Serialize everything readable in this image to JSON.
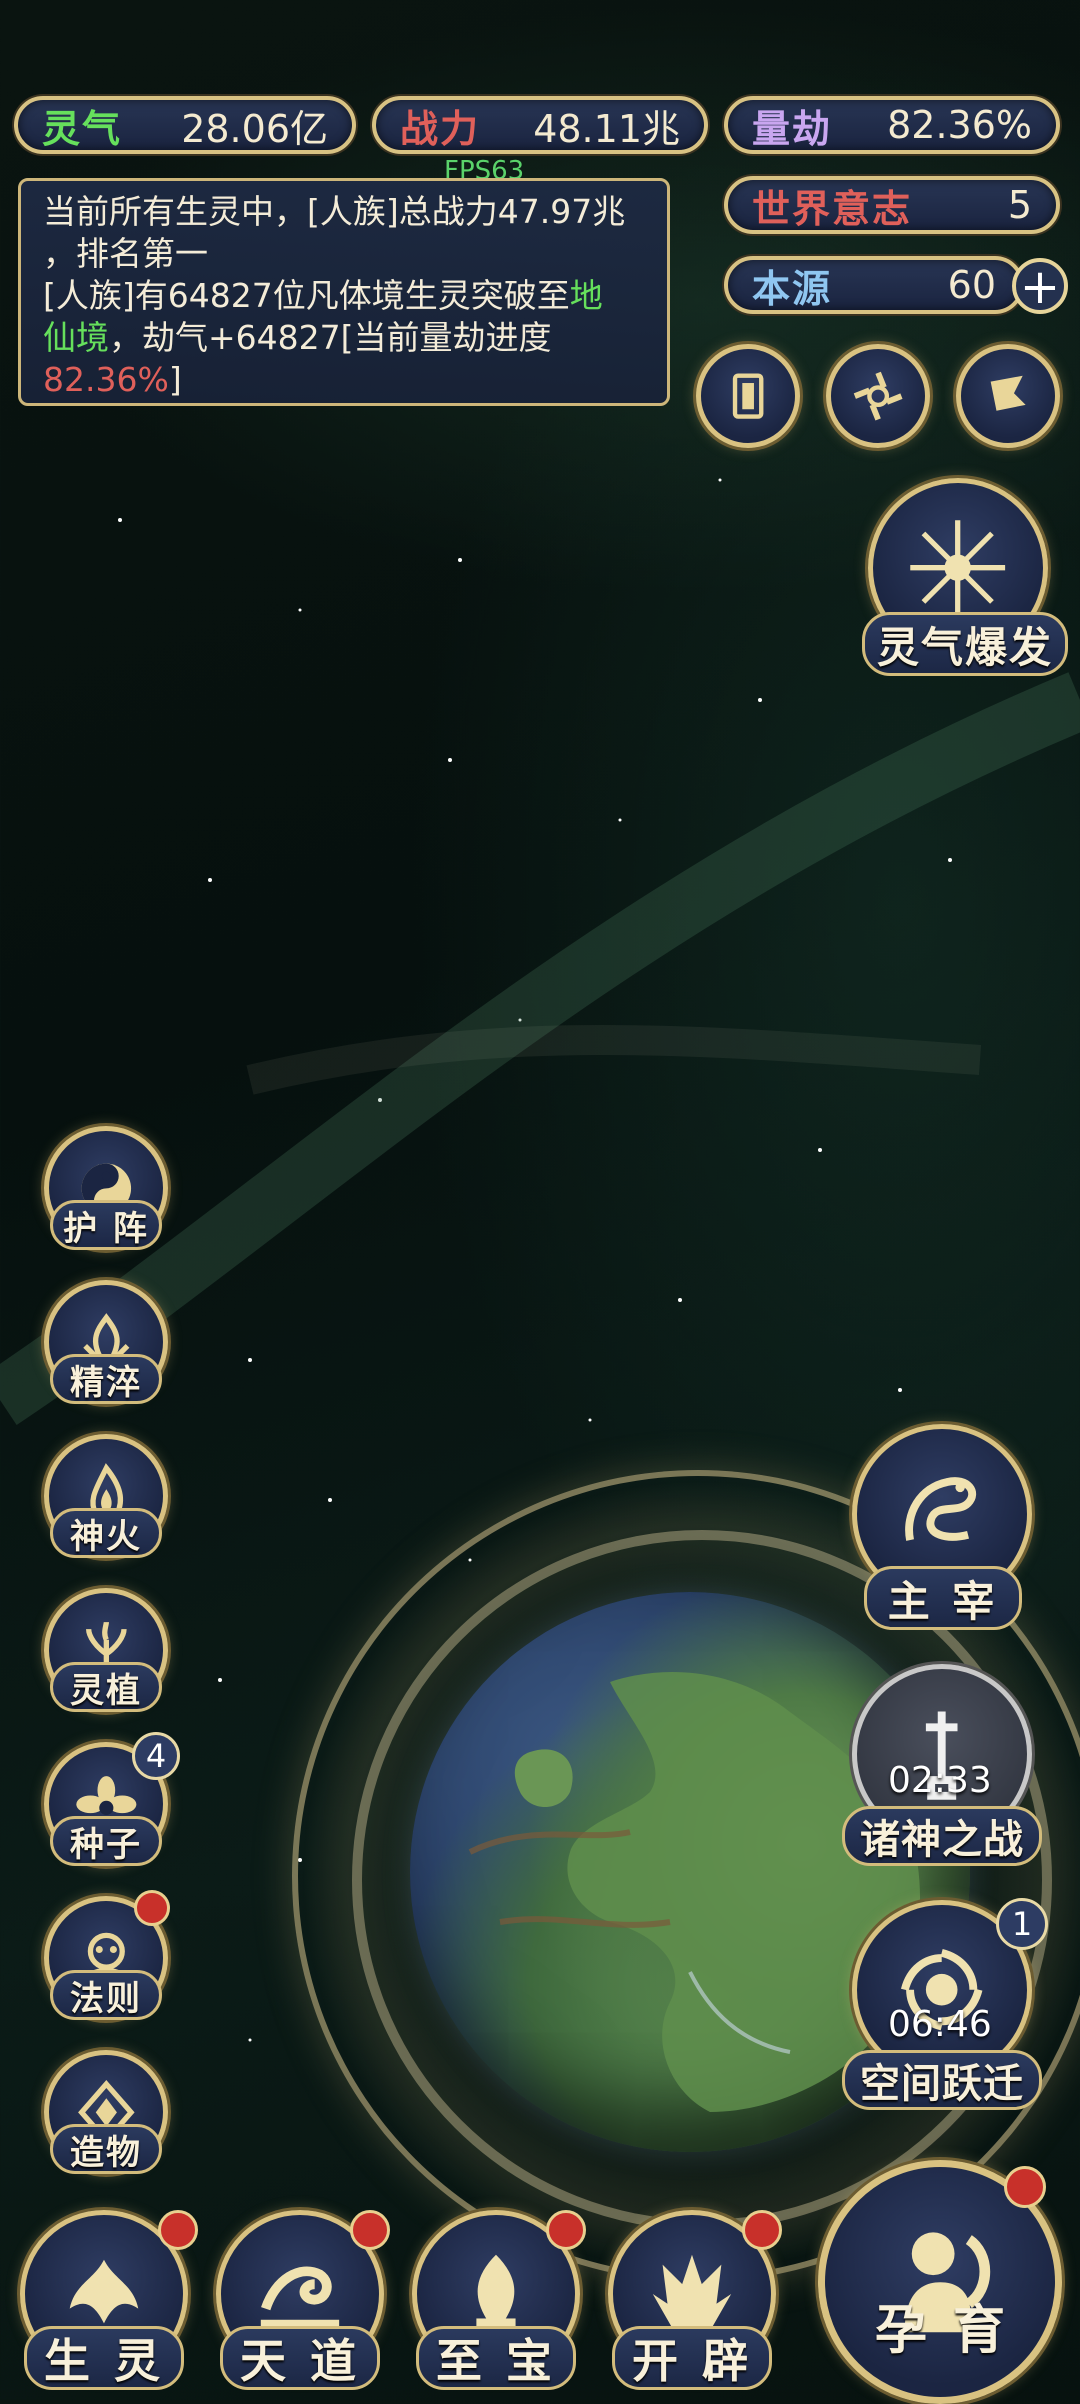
{
  "hud": {
    "lingqi": {
      "label": "灵气",
      "value": "28.06亿",
      "color": "#66e05c"
    },
    "zhanli": {
      "label": "战力",
      "value": "48.11兆",
      "color": "#e0605a"
    },
    "liangjie": {
      "label": "量劫",
      "value": "82.36%",
      "color": "#c9a6f0"
    },
    "shijie": {
      "label": "世界意志",
      "value": "5",
      "color": "#e0605a"
    },
    "benyuan": {
      "label": "本源",
      "value": "60",
      "color": "#8fc6f0"
    },
    "plus_icon": "+",
    "fps": "FPS63"
  },
  "message": {
    "line1": "当前所有生灵中，[人族]总战力47.97兆",
    "line2": "，排名第一",
    "line3a": "[人族]有64827位凡体境生灵突破至",
    "line3b": "地",
    "line4a": "仙境",
    "line4b": "，劫气+64827[当前量劫进度",
    "line5a": "82.36%",
    "line5b": "]"
  },
  "top_icons": [
    {
      "name": "card-icon"
    },
    {
      "name": "vortex-icon"
    },
    {
      "name": "flag-icon"
    }
  ],
  "burst": {
    "label": "灵气爆发",
    "icon": "starburst-icon"
  },
  "left_menu": [
    {
      "label": "护 阵",
      "icon": "yinyang-icon",
      "badge": ""
    },
    {
      "label": "精淬",
      "icon": "lotus-flame-icon",
      "badge": ""
    },
    {
      "label": "神火",
      "icon": "fire-icon",
      "badge": ""
    },
    {
      "label": "灵植",
      "icon": "plant-icon",
      "badge": ""
    },
    {
      "label": "种子",
      "icon": "flower-icon",
      "badge": "4"
    },
    {
      "label": "法则",
      "icon": "totem-icon",
      "badge": "dot"
    },
    {
      "label": "造物",
      "icon": "diamond-icon",
      "badge": ""
    }
  ],
  "right_menu": {
    "zhuzai": {
      "label": "主 宰",
      "icon": "dragon-icon"
    },
    "zhushen": {
      "label": "诸神之战",
      "icon": "sword-icon",
      "timer": "02:33"
    },
    "kongjian": {
      "label": "空间跃迁",
      "icon": "portal-icon",
      "timer": "06:46",
      "badge": "1"
    }
  },
  "bottom_menu": [
    {
      "label": "生 灵",
      "icon": "phoenix-icon"
    },
    {
      "label": "天 道",
      "icon": "wave-icon"
    },
    {
      "label": "至 宝",
      "icon": "treasure-icon"
    },
    {
      "label": "开 辟",
      "icon": "flame-crown-icon"
    }
  ],
  "yuyu": {
    "label": "孕 育",
    "icon": "figure-icon"
  }
}
